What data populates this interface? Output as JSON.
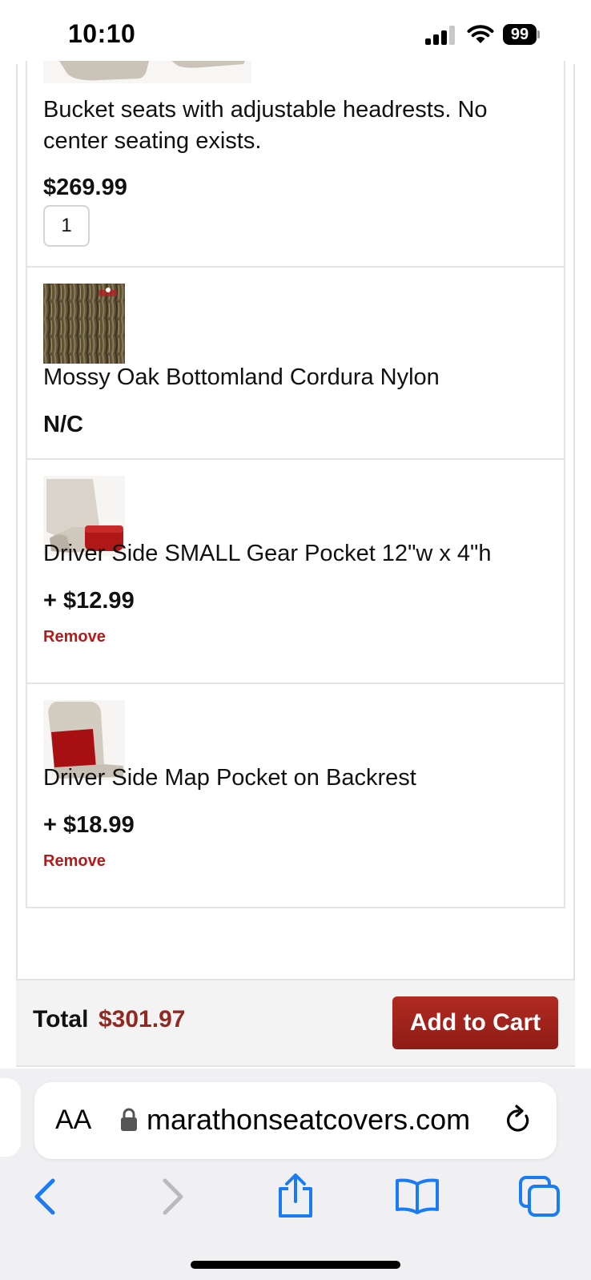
{
  "status_bar": {
    "time": "10:10",
    "battery": "99"
  },
  "items": [
    {
      "title": "Bucket seats with adjustable headrests. No center seating exists.",
      "price": "$269.99",
      "quantity": "1"
    },
    {
      "title": "Mossy Oak Bottomland Cordura Nylon",
      "price": "N/C"
    },
    {
      "title": "Driver Side SMALL Gear Pocket 12\"w x 4\"h",
      "price": "+ $12.99",
      "remove_label": "Remove"
    },
    {
      "title": "Driver Side Map Pocket on Backrest",
      "price": "+ $18.99",
      "remove_label": "Remove"
    }
  ],
  "footer": {
    "total_label": "Total",
    "total_value": "$301.97",
    "add_to_cart_label": "Add to Cart"
  },
  "browser": {
    "aa_label": "AA",
    "url": "marathonseatcovers.com"
  },
  "colors": {
    "accent_red": "#b31b1b",
    "total_red": "#8e2a22",
    "link_blue": "#1a7cf5"
  },
  "icons": [
    "signal-icon",
    "wifi-icon",
    "battery-icon",
    "lock-icon",
    "reload-icon",
    "back-icon",
    "forward-icon",
    "share-icon",
    "bookmarks-icon",
    "tabs-icon"
  ]
}
